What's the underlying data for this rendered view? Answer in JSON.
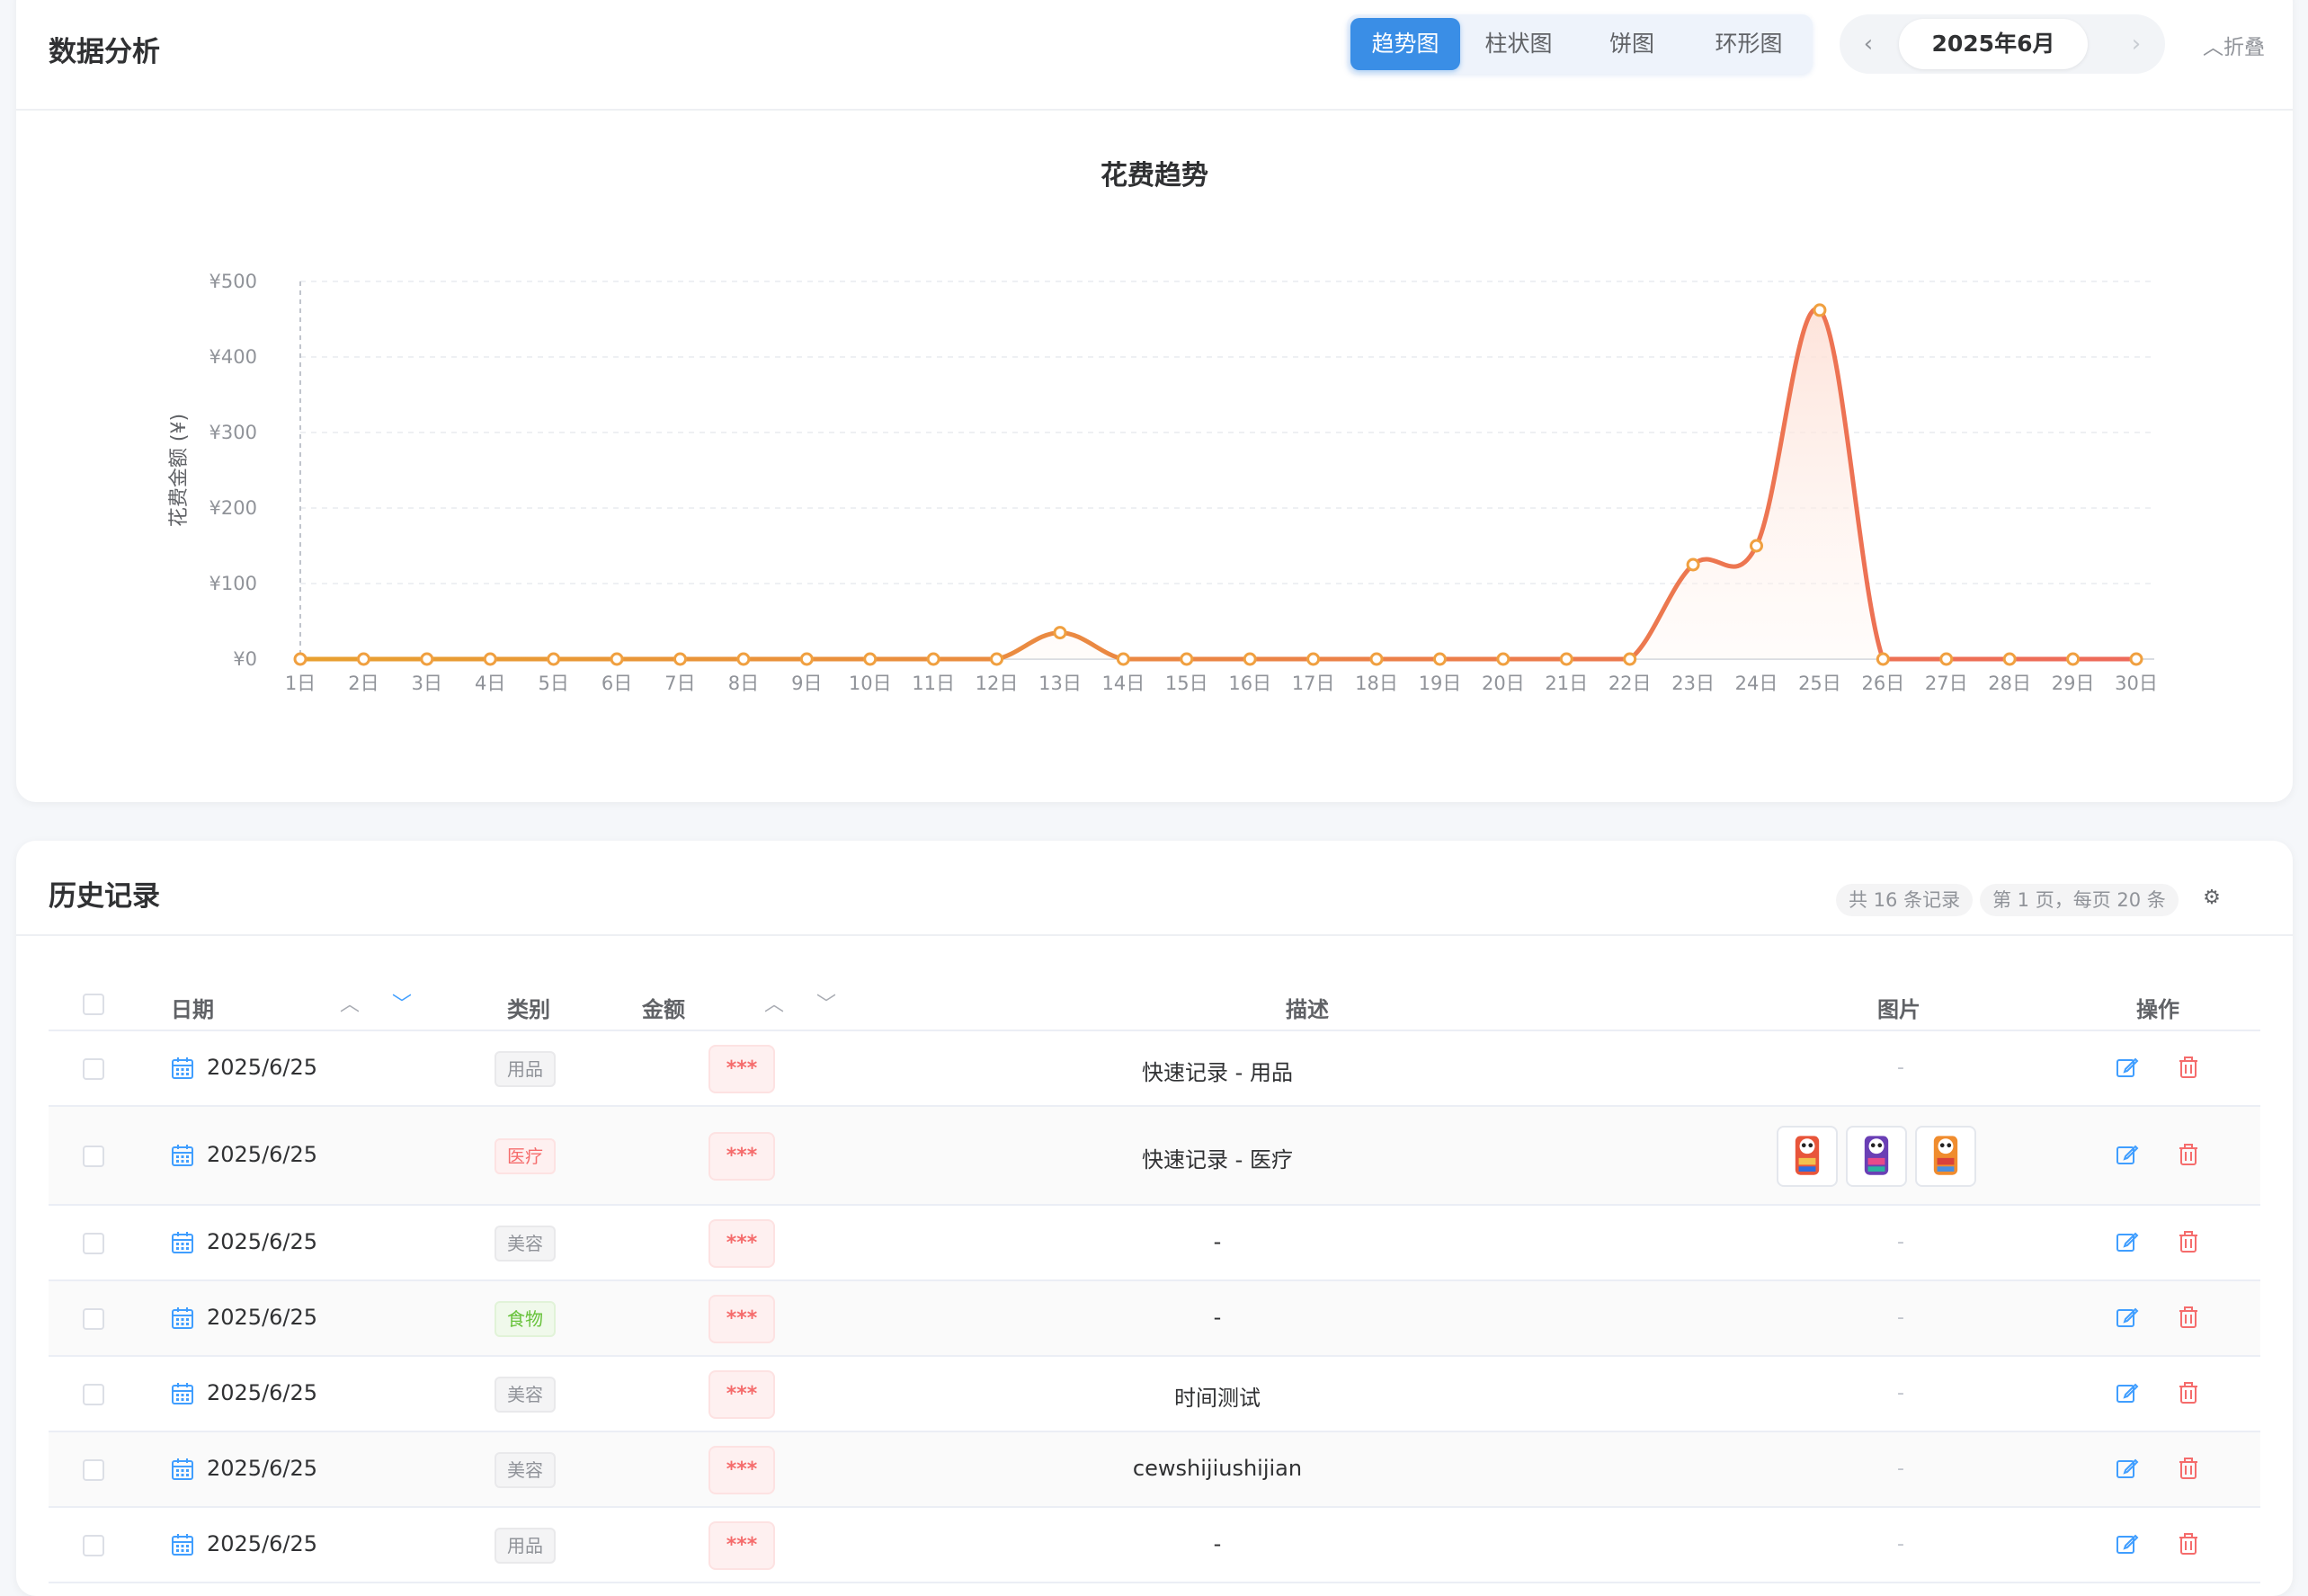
{
  "analysis": {
    "title": "数据分析",
    "tabs": [
      {
        "label": "趋势图",
        "active": true
      },
      {
        "label": "柱状图",
        "active": false
      },
      {
        "label": "饼图",
        "active": false
      },
      {
        "label": "环形图",
        "active": false
      }
    ],
    "month": {
      "label": "2025年6月",
      "prev_icon": "chevron-left-icon",
      "next_icon": "chevron-right-icon"
    },
    "collapse_label": "折叠"
  },
  "chart_data": {
    "type": "area",
    "title": "花费趋势",
    "xlabel": "",
    "ylabel": "花费金额 (¥)",
    "ylim": [
      0,
      500
    ],
    "yticks": [
      "¥0",
      "¥100",
      "¥200",
      "¥300",
      "¥400",
      "¥500"
    ],
    "ytick_values": [
      0,
      100,
      200,
      300,
      400,
      500
    ],
    "categories": [
      "1日",
      "2日",
      "3日",
      "4日",
      "5日",
      "6日",
      "7日",
      "8日",
      "9日",
      "10日",
      "11日",
      "12日",
      "13日",
      "14日",
      "15日",
      "16日",
      "17日",
      "18日",
      "19日",
      "20日",
      "21日",
      "22日",
      "23日",
      "24日",
      "25日",
      "26日",
      "27日",
      "28日",
      "29日",
      "30日"
    ],
    "values": [
      0,
      0,
      0,
      0,
      0,
      0,
      0,
      0,
      0,
      0,
      0,
      0,
      35,
      0,
      0,
      0,
      0,
      0,
      0,
      0,
      0,
      0,
      125,
      150,
      462,
      0,
      0,
      0,
      0,
      0
    ],
    "smooth": true,
    "grid": true,
    "colors": {
      "line_start": "#e8a030",
      "line_end": "#ee6a5a",
      "point_fill": "#ffffff",
      "area": "#fde5dc"
    }
  },
  "history": {
    "title": "历史记录",
    "total_label": "共 16 条记录",
    "page_label": "第 1 页，每页 20 条",
    "settings_icon": "gear-icon",
    "columns": {
      "date": "日期",
      "category": "类别",
      "amount": "金额",
      "description": "描述",
      "images": "图片",
      "actions": "操作"
    },
    "rows": [
      {
        "date": "2025/6/25",
        "category": "用品",
        "cat_style": "gray",
        "amount": "***",
        "description": "快速记录 - 用品",
        "images": "-",
        "image_count": 0
      },
      {
        "date": "2025/6/25",
        "category": "医疗",
        "cat_style": "red",
        "amount": "***",
        "description": "快速记录 - 医疗",
        "images": "",
        "image_count": 3
      },
      {
        "date": "2025/6/25",
        "category": "美容",
        "cat_style": "gray",
        "amount": "***",
        "description": "-",
        "images": "-",
        "image_count": 0
      },
      {
        "date": "2025/6/25",
        "category": "食物",
        "cat_style": "green",
        "amount": "***",
        "description": "-",
        "images": "-",
        "image_count": 0
      },
      {
        "date": "2025/6/25",
        "category": "美容",
        "cat_style": "gray",
        "amount": "***",
        "description": "时间测试",
        "images": "-",
        "image_count": 0
      },
      {
        "date": "2025/6/25",
        "category": "美容",
        "cat_style": "gray",
        "amount": "***",
        "description": "cewshijiushijian",
        "images": "-",
        "image_count": 0
      },
      {
        "date": "2025/6/25",
        "category": "用品",
        "cat_style": "gray",
        "amount": "***",
        "description": "-",
        "images": "-",
        "image_count": 0
      }
    ]
  }
}
